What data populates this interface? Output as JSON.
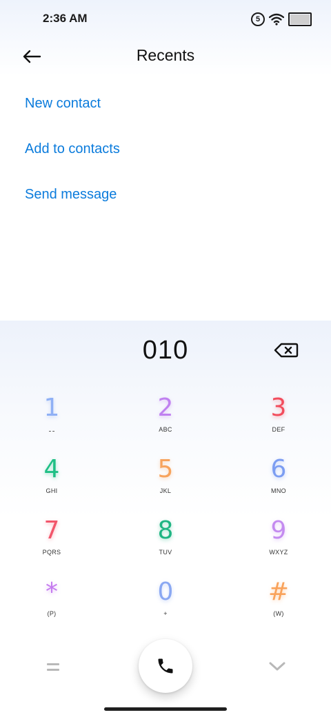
{
  "status_bar": {
    "time": "2:36 AM",
    "sim_label": "5",
    "battery_level": 1.0
  },
  "header": {
    "title": "Recents",
    "back_icon": "back-arrow-icon"
  },
  "actions": [
    {
      "label": "New contact"
    },
    {
      "label": "Add to contacts"
    },
    {
      "label": "Send message"
    }
  ],
  "dialer": {
    "number": "010",
    "backspace_icon": "backspace-icon",
    "keys": [
      {
        "digit": "1",
        "letters": "ـ ـ",
        "color": "#8fb0f5"
      },
      {
        "digit": "2",
        "letters": "ABC",
        "color": "#c081f0"
      },
      {
        "digit": "3",
        "letters": "DEF",
        "color": "#f24c5c"
      },
      {
        "digit": "4",
        "letters": "GHI",
        "color": "#1fbf85"
      },
      {
        "digit": "5",
        "letters": "JKL",
        "color": "#f7a35c"
      },
      {
        "digit": "6",
        "letters": "MNO",
        "color": "#7c9df2"
      },
      {
        "digit": "7",
        "letters": "PQRS",
        "color": "#f2566b"
      },
      {
        "digit": "8",
        "letters": "TUV",
        "color": "#1fb583"
      },
      {
        "digit": "9",
        "letters": "WXYZ",
        "color": "#c48bf0"
      },
      {
        "digit": "*",
        "letters": "(P)",
        "color": "#c57bef"
      },
      {
        "digit": "0",
        "letters": "+",
        "color": "#8aa8f2"
      },
      {
        "digit": "#",
        "letters": "(W)",
        "color": "#f9a25a"
      }
    ],
    "menu_icon": "menu-icon",
    "call_icon": "phone-icon",
    "collapse_icon": "chevron-down-icon"
  },
  "colors": {
    "link": "#0a7bdc",
    "text": "#111111"
  }
}
